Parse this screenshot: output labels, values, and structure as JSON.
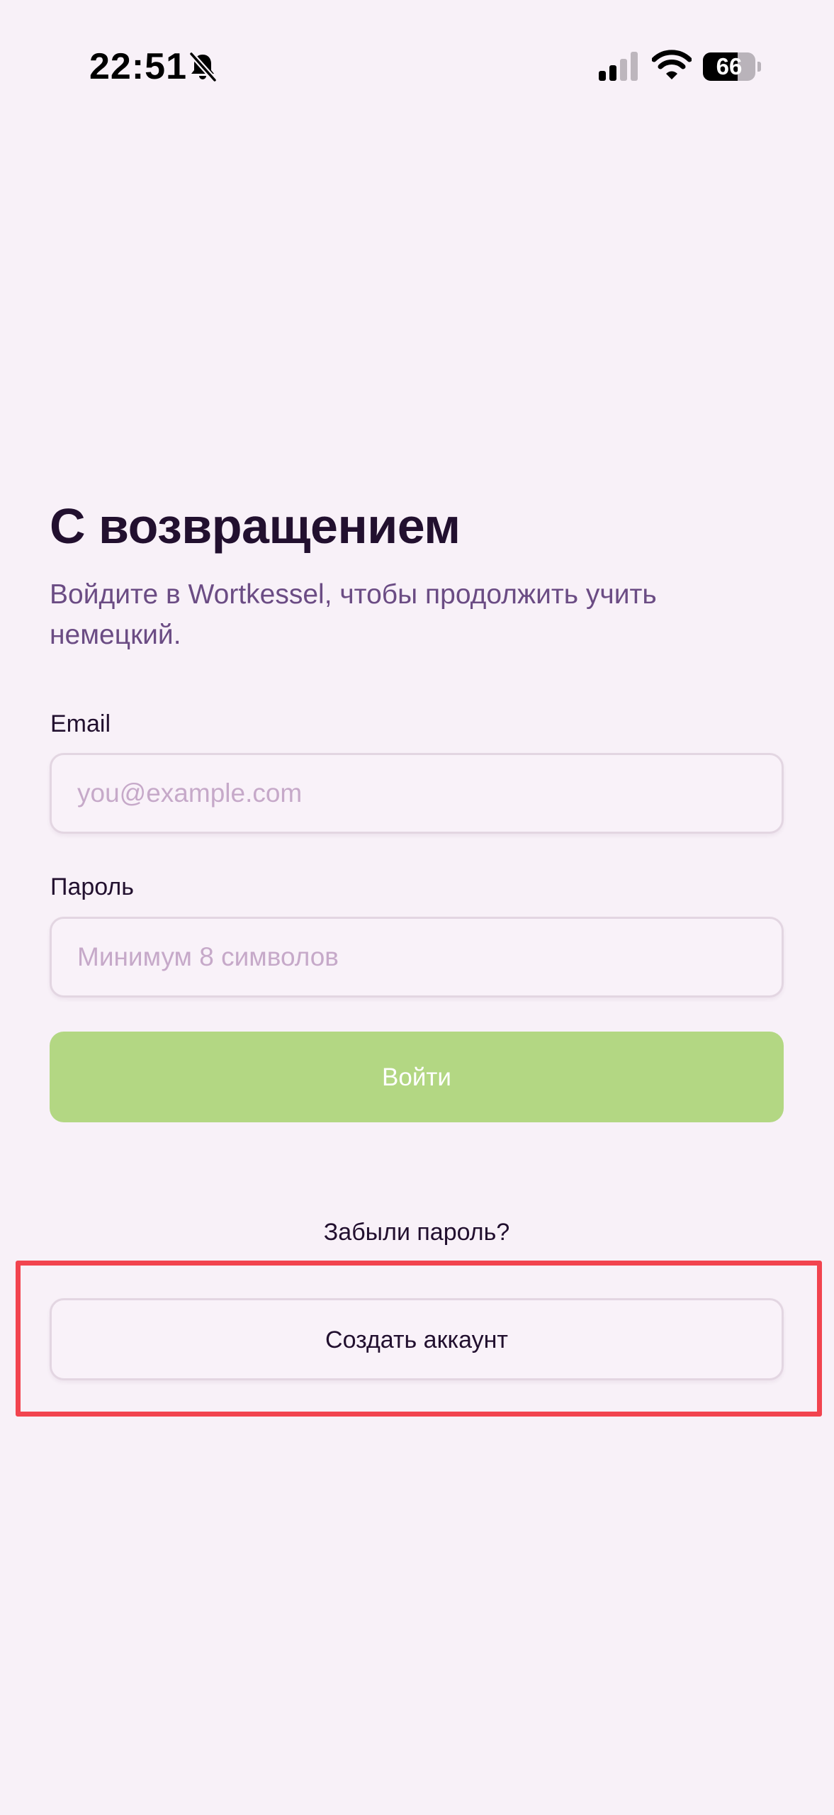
{
  "status_bar": {
    "time": "22:51",
    "battery_level": "66",
    "icons": [
      "bell-slash-icon",
      "cellular-signal-icon",
      "wifi-icon",
      "battery-icon"
    ]
  },
  "login": {
    "title": "С возвращением",
    "subtitle": "Войдите в Wortkessel, чтобы продолжить учить немецкий.",
    "email_label": "Email",
    "email_placeholder": "you@example.com",
    "password_label": "Пароль",
    "password_placeholder": "Минимум 8 символов",
    "submit_label": "Войти",
    "forgot_password": "Забыли пароль?",
    "create_account": "Создать аккаунт"
  },
  "colors": {
    "background": "#f8f1f8",
    "title": "#22102f",
    "subtitle": "#6b4c84",
    "primary_button": "#b3d783",
    "input_border": "#e3d6e2",
    "placeholder": "#c6a9c9",
    "highlight": "#f2444f"
  }
}
